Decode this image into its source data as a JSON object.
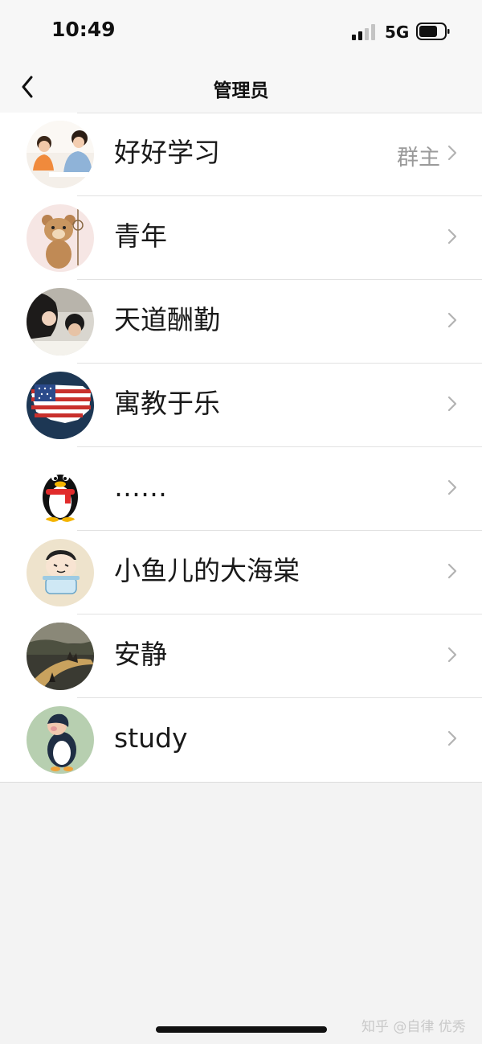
{
  "status_bar": {
    "time": "10:49",
    "network": "5G",
    "icons": [
      "signal-icon",
      "battery-icon"
    ]
  },
  "nav": {
    "title": "管理员",
    "back_icon": "chevron-left-icon"
  },
  "members": [
    {
      "name": "好好学习",
      "role": "群主",
      "avatar": "teacher-student-photo"
    },
    {
      "name": "青年",
      "role": "",
      "avatar": "cartoon-bear"
    },
    {
      "name": "天道酬勤",
      "role": "",
      "avatar": "studying-photo"
    },
    {
      "name": "寓教于乐",
      "role": "",
      "avatar": "us-flag-map"
    },
    {
      "name": "……",
      "role": "",
      "avatar": "qq-penguin"
    },
    {
      "name": "小鱼儿的大海棠",
      "role": "",
      "avatar": "cartoon-boy"
    },
    {
      "name": "安静",
      "role": "",
      "avatar": "sunset-landscape"
    },
    {
      "name": "study",
      "role": "",
      "avatar": "cartoon-penguin-costume"
    }
  ],
  "watermark": "知乎 @自律 优秀",
  "colors": {
    "background": "#f3f3f3",
    "list_background": "#ffffff",
    "text": "#1a1a1a",
    "secondary_text": "#9a9a9a",
    "chevron": "#b3b3b3"
  }
}
